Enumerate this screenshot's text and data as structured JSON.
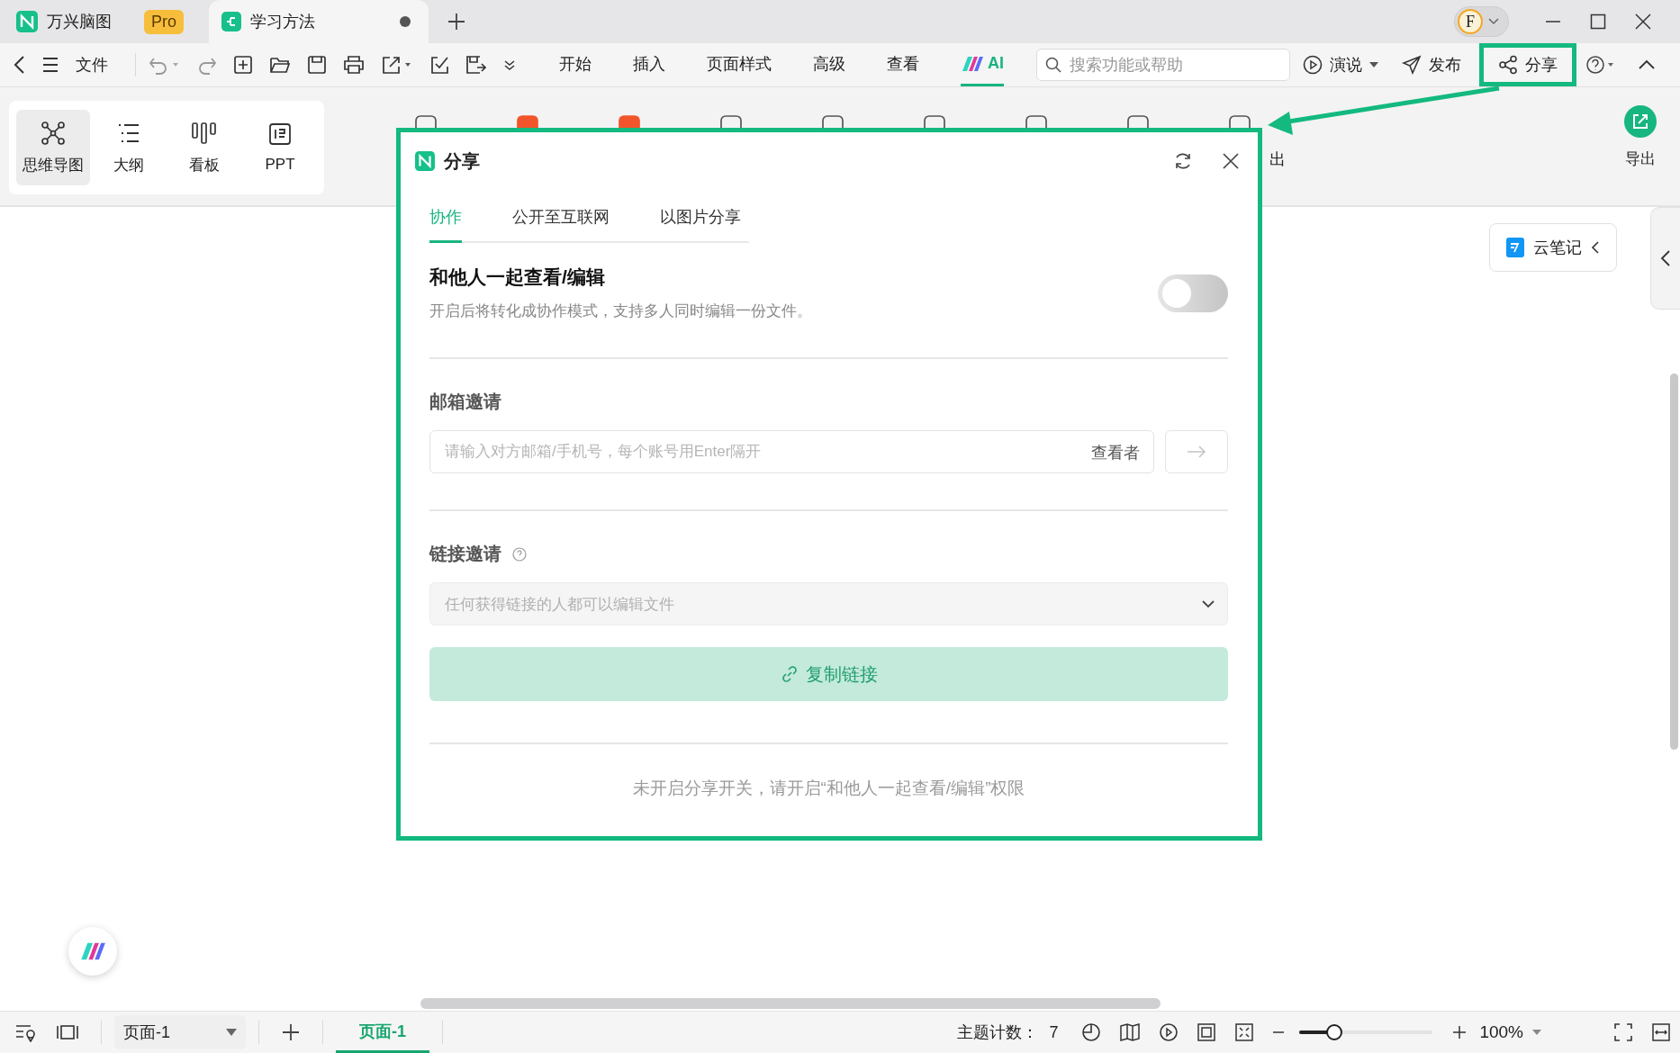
{
  "app_tabs": [
    {
      "kind": "app",
      "label": "万兴脑图",
      "badge": "Pro",
      "selected": false
    },
    {
      "kind": "doc",
      "label": "学习方法",
      "unsaved": true,
      "selected": true
    }
  ],
  "avatar": {
    "initial": "F"
  },
  "toolbar": {
    "file": "文件",
    "menu_tabs": [
      {
        "label": "开始",
        "kind": "text",
        "selected": false
      },
      {
        "label": "插入",
        "kind": "text",
        "selected": false
      },
      {
        "label": "页面样式",
        "kind": "text",
        "selected": false
      },
      {
        "label": "高级",
        "kind": "text",
        "selected": false
      },
      {
        "label": "查看",
        "kind": "text",
        "selected": false
      },
      {
        "label": "AI",
        "kind": "ai",
        "selected": true
      }
    ],
    "search": {
      "placeholder": "搜索功能或帮助"
    },
    "actions": [
      {
        "label": "演说",
        "kind": "present",
        "highlighted": false
      },
      {
        "label": "发布",
        "kind": "publish",
        "highlighted": false
      },
      {
        "label": "分享",
        "kind": "share",
        "highlighted": true
      }
    ]
  },
  "views": [
    {
      "label": "思维导图",
      "kind": "mindmap",
      "selected": true
    },
    {
      "label": "大纲",
      "kind": "outline",
      "selected": false
    },
    {
      "label": "看板",
      "kind": "board",
      "selected": false
    },
    {
      "label": "PPT",
      "kind": "ppt",
      "selected": false
    }
  ],
  "ribbon_partial_label": "出",
  "export": {
    "label": "导出"
  },
  "cloud_notes": {
    "label": "云笔记"
  },
  "dialog": {
    "title": "分享",
    "tabs": [
      {
        "label": "协作",
        "selected": true
      },
      {
        "label": "公开至互联网",
        "selected": false
      },
      {
        "label": "以图片分享",
        "selected": false
      }
    ],
    "collab": {
      "title": "和他人一起查看/编辑",
      "description": "开启后将转化成协作模式，支持多人同时编辑一份文件。",
      "on": false
    },
    "email": {
      "title": "邮箱邀请",
      "placeholder": "请输入对方邮箱/手机号，每个账号用Enter隔开",
      "role": "查看者",
      "send_disabled": true
    },
    "link": {
      "title": "链接邀请",
      "permission": "任何获得链接的人都可以编辑文件",
      "button": "复制链接",
      "disabled": true
    },
    "note": "未开启分享开关，请开启“和他人一起查看/编辑”权限"
  },
  "status_bar": {
    "page_select": "页面-1",
    "pages": [
      {
        "label": "页面-1",
        "selected": true
      }
    ],
    "topic_count_label": "主题计数：",
    "topic_count": "7",
    "zoom": {
      "level": 0.26
    },
    "zoom_text": "100%"
  }
}
